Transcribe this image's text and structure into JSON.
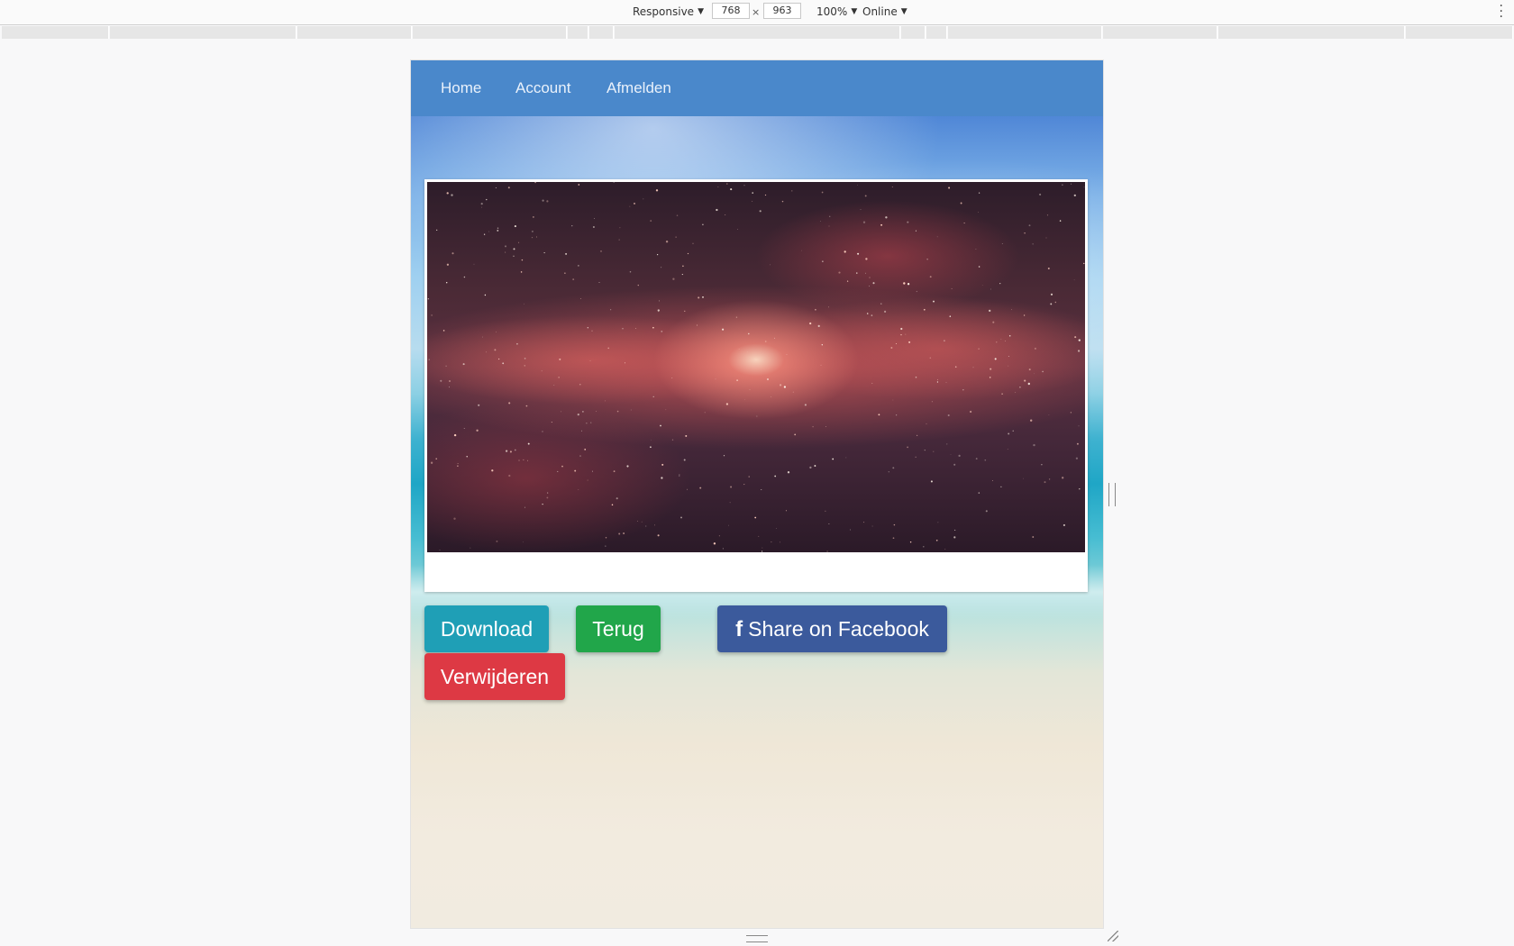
{
  "devtools": {
    "device_mode": "Responsive",
    "width": "768",
    "times": "×",
    "height": "963",
    "zoom": "100%",
    "network": "Online",
    "caret": "▼",
    "menu_icon": "kebab-menu-icon"
  },
  "navbar": {
    "items": [
      {
        "label": "Home"
      },
      {
        "label": "Account"
      },
      {
        "label": "Afmelden"
      }
    ],
    "color": "#4a88cb"
  },
  "photo": {
    "description_icon": "galaxy-image"
  },
  "buttons": {
    "download": "Download",
    "back": "Terug",
    "share": "Share on Facebook",
    "share_icon": "facebook-icon",
    "delete": "Verwijderen"
  },
  "colors": {
    "download": "#1f9fb6",
    "back": "#21a64a",
    "share": "#3b5a9c",
    "delete": "#dd3944"
  }
}
